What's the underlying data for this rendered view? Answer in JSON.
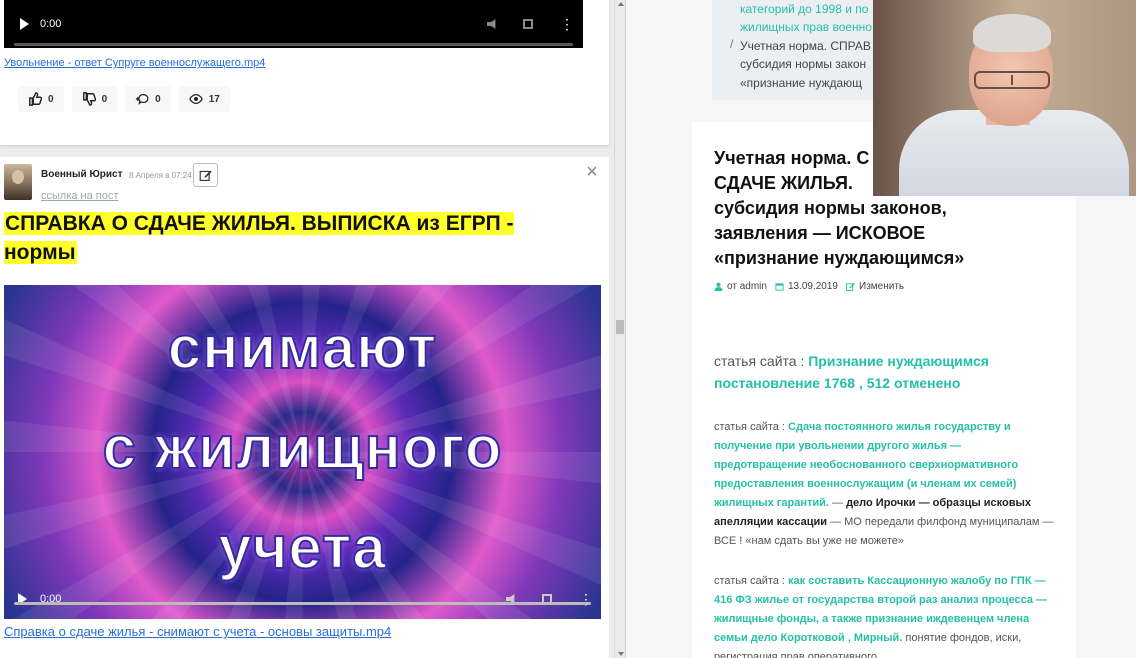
{
  "left": {
    "post1": {
      "video_time": "0:00",
      "file_link": "Увольнение - ответ Супруге военнослужащего.mp4",
      "stats": {
        "likes": "0",
        "dislikes": "0",
        "comments": "0",
        "views": "17"
      }
    },
    "post2": {
      "author": "Военный Юрист",
      "date": "8 Апреля в 07:24",
      "post_link": "ссылка на пост",
      "headline": "СПРАВКА О СДАЧЕ ЖИЛЬЯ. ВЫПИСКА из ЕГРП - нормы",
      "thumb_lines": [
        "снимают",
        "с жилищного",
        "учета"
      ],
      "video_time": "0:00",
      "file_link": "Справка о сдаче жилья - снимают с учета - основы защиты.mp4"
    }
  },
  "right": {
    "breadcrumb": {
      "line1": "категорий до 1998 и по",
      "line2": "жилищных прав военно",
      "sep": "/",
      "line3": "Учетная норма. СПРАВ",
      "line4": "субсидия нормы закон",
      "line5": "«признание нуждающ"
    },
    "article": {
      "title_lines": [
        "Учетная норма. С",
        "СДАЧЕ ЖИЛЬЯ. ",
        "субсидия нормы законов,",
        "заявления — ИСКОВОЕ",
        "«признание нуждающимся»"
      ],
      "meta": {
        "author": "от admin",
        "date": "13.09.2019",
        "edit": "Изменить"
      },
      "sec1": {
        "prefix": "статья сайта : ",
        "link": "Признание нуждающимся постановление 1768 , 512 отменено"
      },
      "sec2": {
        "prefix": "статья сайта : ",
        "link": "Сдача постоянного жилья государству и получение при увольнении другого жилья — предотвращение необоснованного сверхнормативного предоставления военнослужащим (и членам их семей) жилищных гарантий.",
        "mid1": " — ",
        "bold": "дело Ирочки — образцы исковых апелляции кассации",
        "tail": " — МО передали филфонд муниципалам — ВСЕ ! «нам сдать вы уже не можете»"
      },
      "sec3": {
        "prefix": "статья сайта : ",
        "link": "как составить Кассационную жалобу по ГПК — 416 ФЗ жилье от государства второй раз анализ процесса — жилищные фонды, а также признание иждевенцем члена семьи дело Коротковой , Мирный.",
        "tail": " понятие фондов, иски, регистрация прав оперативного"
      }
    }
  },
  "colors": {
    "accent_teal": "#26c0a8",
    "link_blue": "#2a6ed4",
    "highlight_yellow": "#ffff2a"
  }
}
